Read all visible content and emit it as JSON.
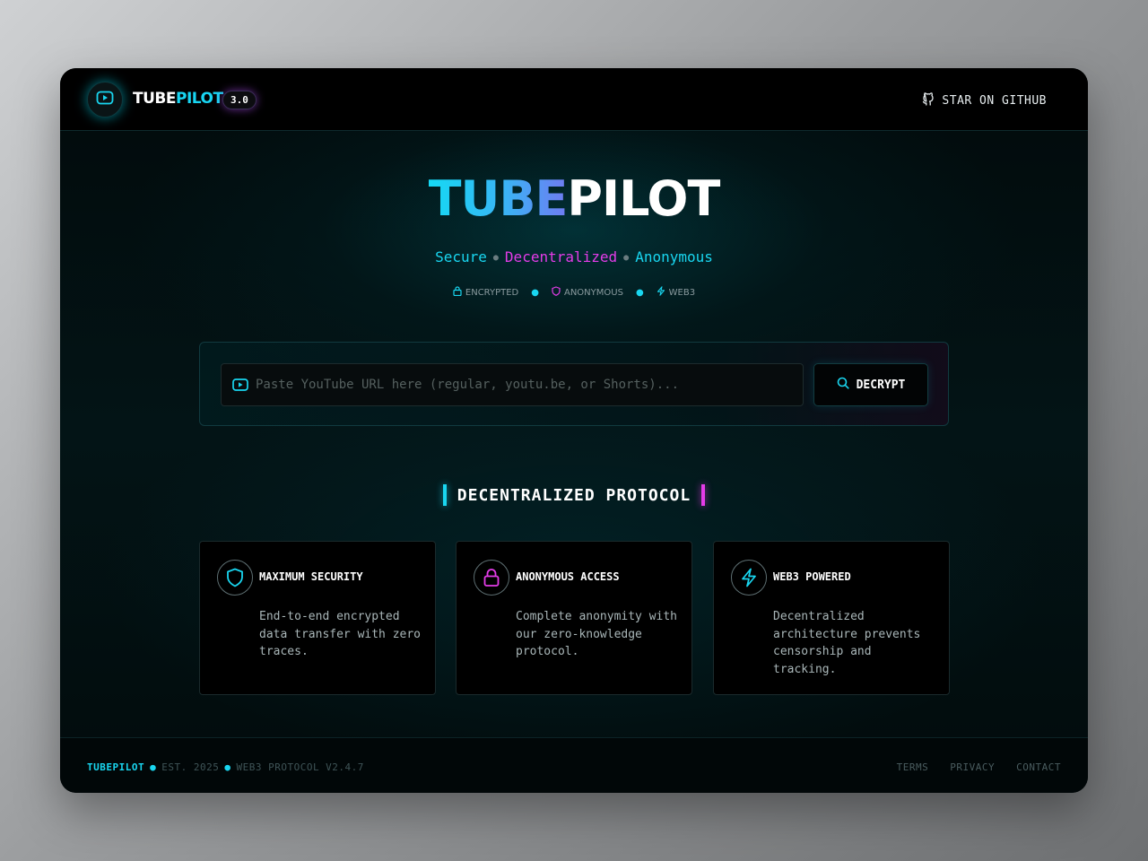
{
  "header": {
    "brand_white": "TUBE",
    "brand_cyan": "PILOT",
    "version": "3.0",
    "github_label": "STAR ON GITHUB"
  },
  "hero": {
    "title_gradient": "TUBE",
    "title_white": "PILOT",
    "tagline": [
      "Secure",
      "Decentralized",
      "Anonymous"
    ],
    "badges": [
      "ENCRYPTED",
      "ANONYMOUS",
      "WEB3"
    ]
  },
  "search": {
    "placeholder": "Paste YouTube URL here (regular, youtu.be, or Shorts)...",
    "value": "",
    "button_label": "DECRYPT"
  },
  "section": {
    "heading": "DECENTRALIZED PROTOCOL"
  },
  "features": [
    {
      "icon": "shield-icon",
      "title": "MAXIMUM SECURITY",
      "description": "End-to-end encrypted data transfer with zero traces."
    },
    {
      "icon": "lock-icon",
      "title": "ANONYMOUS ACCESS",
      "description": "Complete anonymity with our zero-knowledge protocol."
    },
    {
      "icon": "bolt-icon",
      "title": "WEB3 POWERED",
      "description": "Decentralized architecture prevents censorship and tracking."
    }
  ],
  "footer": {
    "brand": "TUBEPILOT",
    "est": "EST. 2025",
    "protocol": "WEB3 PROTOCOL V2.4.7",
    "links": [
      "TERMS",
      "PRIVACY",
      "CONTACT"
    ]
  },
  "colors": {
    "cyan": "#19d6f0",
    "magenta": "#e43ce8",
    "background": "#020a0b"
  }
}
